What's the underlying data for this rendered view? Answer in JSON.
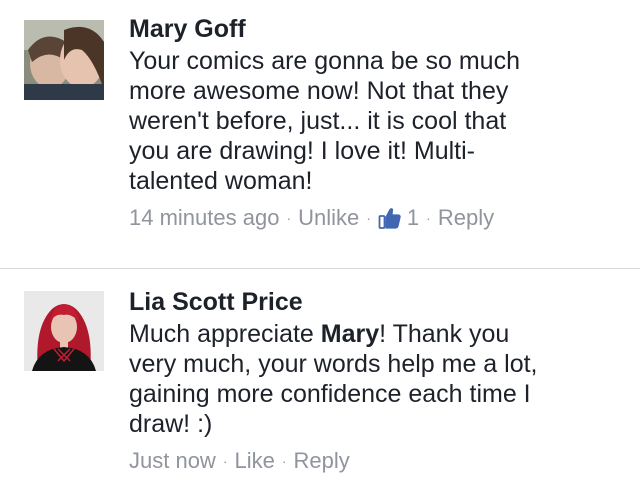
{
  "comments": [
    {
      "author": "Mary Goff",
      "text": "Your comics are gonna be so much\nmore awesome now! Not that they\nweren't before, just... it is cool that\nyou are drawing! I love it! Multi-\ntalented woman!",
      "timestamp": "14 minutes ago",
      "like_action": "Unlike",
      "like_count": "1",
      "reply": "Reply",
      "separator": "·",
      "accent_color": "#4267b2"
    },
    {
      "author": "Lia Scott Price",
      "text_before": "Much appreciate ",
      "mention": "Mary",
      "text_after": "! Thank you\nvery much, your words help me a lot,\ngaining more confidence each time I\ndraw! :)",
      "timestamp": "Just now",
      "like_action": "Like",
      "reply": "Reply",
      "separator": "·"
    }
  ],
  "colors": {
    "text": "#1d2129",
    "meta": "#90949c",
    "divider": "#d9dadd",
    "like_blue": "#4267b2"
  },
  "icons": {
    "avatar_1": "profile-photo-mary",
    "avatar_2": "profile-photo-lia",
    "like": "thumbs-up-icon"
  }
}
